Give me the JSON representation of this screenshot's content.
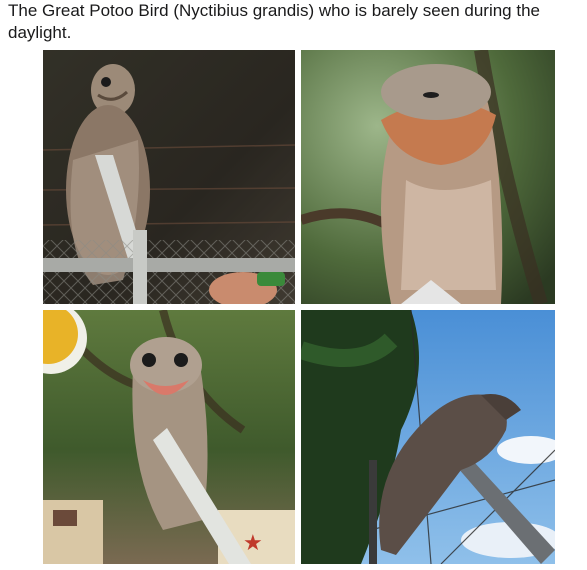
{
  "post": {
    "caption": "The Great Potoo Bird (Nyctibius grandis) who is barely seen during the daylight."
  },
  "photos": [
    {
      "name": "potoo-on-fence-pole",
      "scene": "night"
    },
    {
      "name": "potoo-closeup-tree",
      "scene": "forest"
    },
    {
      "name": "potoo-open-beak",
      "scene": "park"
    },
    {
      "name": "potoo-on-pole-sky",
      "scene": "sky"
    }
  ]
}
